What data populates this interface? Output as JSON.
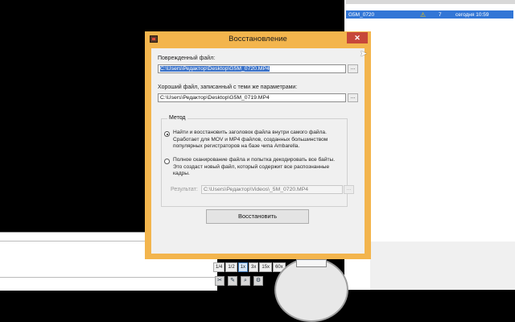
{
  "background_list": {
    "row": {
      "name": "G5M_0720",
      "count": "7",
      "date": "сегодня 10:59"
    }
  },
  "dialog": {
    "title": "Восстановление",
    "close_glyph": "✕",
    "damaged_label": "Поврежденный файл:",
    "damaged_value": "C:\\Users\\Редактор\\Desktop\\G5M_0720.MP4",
    "good_label": "Хороший файл, записанный с теми же параметрами:",
    "good_value": "C:\\Users\\Редактор\\Desktop\\G5M_0719.MP4",
    "browse_label": "...",
    "method_label": "Метод",
    "option1_lines": [
      "Найти и восстановить заголовок файла внутри самого файла.",
      "Сработает для MOV и MP4 файлов, созданных большинством",
      "популярных регистраторов на базе чипа Ambarella."
    ],
    "option2_lines": [
      "Полное сканирование файла и попытка декодировать все байты.",
      "Это создаст новый файл, который содержит все распознанные",
      "кадры."
    ],
    "option1_selected": true,
    "result_label": "Результат:",
    "result_value": "C:\\Users\\Редактор\\Videos\\_5M_0720.MP4",
    "restore_button": "Восстановить"
  },
  "player": {
    "speeds": [
      "1/4",
      "1/2",
      "1x",
      "3x",
      "15x",
      "60x"
    ],
    "active_speed": "1x"
  },
  "colors": {
    "window_frame": "#f3b54d",
    "close_button": "#c7473a",
    "selection": "#3a72c9"
  }
}
